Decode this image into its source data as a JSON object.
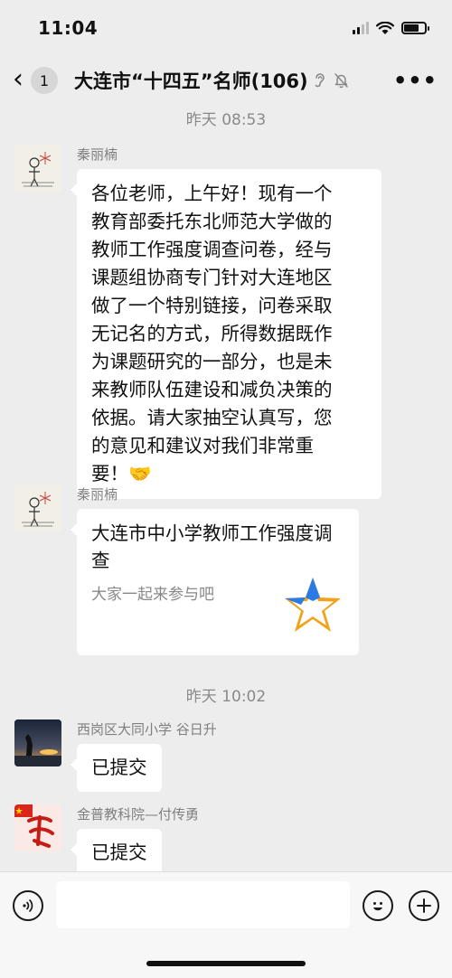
{
  "status_bar": {
    "time": "11:04"
  },
  "nav": {
    "unread_count": "1",
    "title": "大连市“十四五”名师(106)"
  },
  "messages": [
    {
      "type": "timestamp",
      "text": "昨天 08:53"
    },
    {
      "type": "text",
      "sender": "秦丽楠",
      "lines": [
        "各位老师，上午好！现有一个",
        "教育部委托东北师范大学做的",
        "教师工作强度调查问卷，经与",
        "课题组协商专门针对大连地区",
        "做了一个特别链接，问卷采取",
        "无记名的方式，所得数据既作",
        "为课题研究的一部分，也是未",
        "来教师队伍建设和减负决策的",
        "依据。请大家抽空认真写，您",
        "的意见和建议对我们非常重",
        "要！🤝"
      ]
    },
    {
      "type": "card",
      "sender": "秦丽楠",
      "title": "大连市中小学教师工作强度调查",
      "description": "大家一起来参与吧"
    },
    {
      "type": "timestamp",
      "text": "昨天 10:02"
    },
    {
      "type": "text",
      "sender": "西岗区大同小学 谷日升",
      "text": "已提交"
    },
    {
      "type": "text",
      "sender": "金普教科院—付传勇",
      "text": "已提交"
    }
  ],
  "input_bar": {
    "voice_icon": "voice-icon",
    "emoji_icon": "emoji-icon",
    "add_icon": "plus-icon"
  },
  "colors": {
    "background": "#ededed",
    "bubble": "#ffffff",
    "timestamp_text": "#8a8a8a"
  }
}
